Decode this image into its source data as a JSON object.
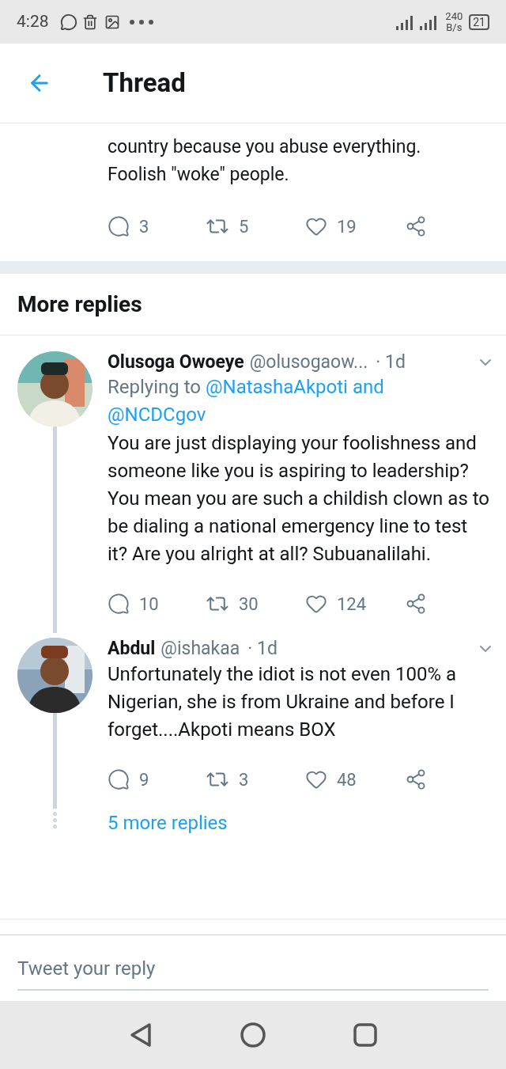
{
  "status_bar": {
    "time": "4:28",
    "speed": "240",
    "speed_unit": "B/s",
    "battery": "21"
  },
  "header": {
    "title": "Thread"
  },
  "top_tweet": {
    "text_lines": [
      "country because you abuse everything.",
      "Foolish \"woke\" people."
    ],
    "replies": "3",
    "retweets": "5",
    "likes": "19"
  },
  "section_title": "More replies",
  "replies": [
    {
      "name": "Olusoga Owoeye",
      "handle": "@olusogaow...",
      "time": "· 1d",
      "replying_to": {
        "prefix": "Replying to",
        "mentions": [
          "@NatashaAkpoti",
          "@NCDCgov"
        ],
        "joiner": "and"
      },
      "text": "You are just displaying your foolishness and someone like you is aspiring to leadership? You mean you are such a childish clown as to be dialing a national emergency line to test it? Are you alright at all? Subuanalilahi.",
      "replies": "10",
      "retweets": "30",
      "likes": "124"
    },
    {
      "name": "Abdul",
      "handle": "@ishakaa",
      "time": "· 1d",
      "text": "Unfortunately the idiot is not even 100% a Nigerian, she is from Ukraine and before I forget....Akpoti means BOX",
      "replies": "9",
      "retweets": "3",
      "likes": "48"
    }
  ],
  "more_replies": "5 more replies",
  "composer": {
    "placeholder": "Tweet your reply"
  }
}
